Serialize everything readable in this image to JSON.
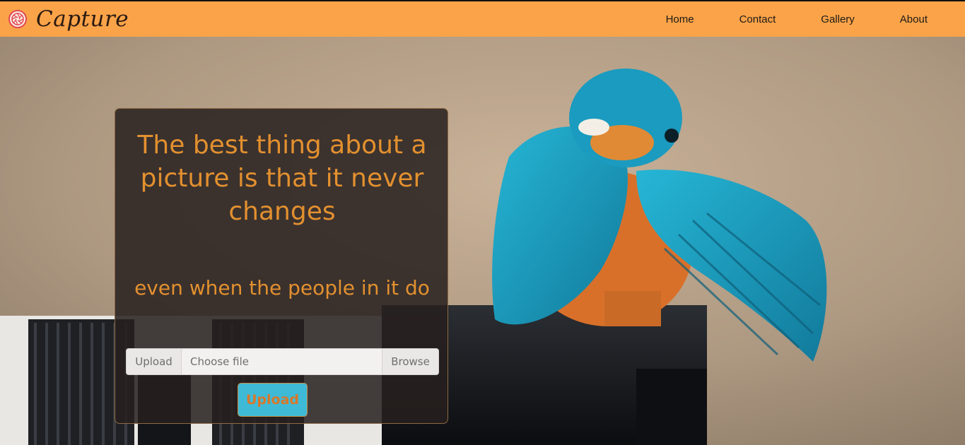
{
  "brand": {
    "name": "Capture",
    "logo_icon": "camera-aperture-icon",
    "logo_color": "#e04a52"
  },
  "nav": {
    "items": [
      "Home",
      "Contact",
      "Gallery",
      "About"
    ],
    "background": "#fba348"
  },
  "hero": {
    "image": "kingfisher-on-camera-lens",
    "quote": "The best thing about a picture is that it never changes",
    "subquote": "even when the people in it do",
    "quote_color": "#e3902f"
  },
  "upload": {
    "prefix_label": "Upload",
    "file_placeholder": "Choose file",
    "browse_label": "Browse",
    "button_label": "Upload",
    "button_color": "#3fbad6"
  }
}
